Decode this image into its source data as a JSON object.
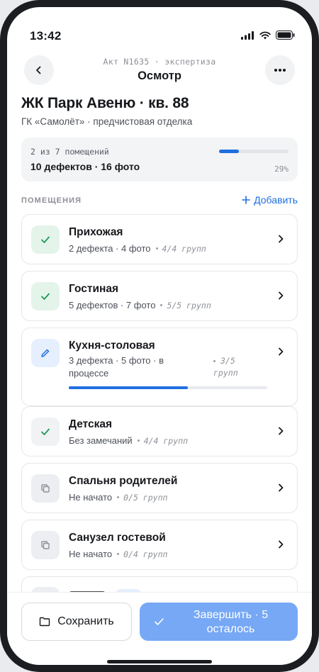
{
  "status": {
    "time": "13:42"
  },
  "nav": {
    "subtitle": "Акт N1635 · экспертиза",
    "title": "Осмотр",
    "back_icon": "chevron-left-icon",
    "more_icon": "more-horizontal-icon"
  },
  "object": {
    "title": "ЖК Парк Авеню · кв. 88",
    "subtitle": "ГК «Самолёт» · предчистовая отделка"
  },
  "summary": {
    "rooms": "2 из 7 помещений",
    "stats": "10 дефектов · 16 фото",
    "percent": "29%",
    "progress": 0.29
  },
  "section": {
    "label": "ПОМЕЩЕНИЯ",
    "add_label": "Добавить"
  },
  "rooms": [
    {
      "name": "Прихожая",
      "meta": "2 дефекта · 4 фото",
      "groups": "4/4 групп",
      "state": "done",
      "icon": "check-icon"
    },
    {
      "name": "Гостиная",
      "meta": "5 дефектов · 7 фото",
      "groups": "5/5 групп",
      "state": "done",
      "icon": "check-icon"
    },
    {
      "name": "Кухня-столовая",
      "meta": "3 дефекта · 5 фото · в процессе",
      "groups": "3/5 групп",
      "state": "active",
      "icon": "pencil-icon",
      "progress": 0.6
    },
    {
      "name": "Детская",
      "meta": "Без замечаний",
      "groups": "4/4 групп",
      "state": "clean",
      "icon": "check-icon"
    },
    {
      "name": "Спальня родителей",
      "meta": "Не начато",
      "groups": "0/5 групп",
      "state": "todo",
      "icon": "copy-icon"
    },
    {
      "name": "Санузел гостевой",
      "meta": "Не начато",
      "groups": "0/4 групп",
      "state": "todo",
      "icon": "copy-icon"
    }
  ],
  "actions": {
    "save_label": "Сохранить",
    "finish_label": "Завершить · 5 осталось"
  },
  "colors": {
    "accent": "#1f6fe0",
    "done": "#1f9a5a",
    "finish_button": "#76a8f5"
  }
}
